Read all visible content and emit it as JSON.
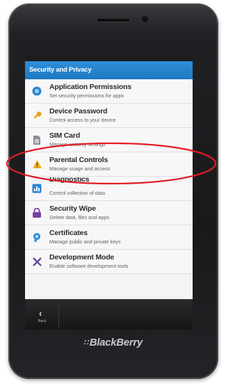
{
  "screen": {
    "header_title": "Security and Privacy"
  },
  "settings_items": [
    {
      "title": "Application Permissions",
      "description": "Set security permissions for apps",
      "icon": "app-permissions-icon"
    },
    {
      "title": "Device Password",
      "description": "Control access to your device",
      "icon": "key-icon"
    },
    {
      "title": "SIM Card",
      "description": "Manage security settings",
      "icon": "sim-card-icon"
    },
    {
      "title": "Parental Controls",
      "description": "Manage usage and access",
      "icon": "warning-icon"
    },
    {
      "title": "Diagnostics",
      "description": "Control collection of data",
      "icon": "diagnostics-icon"
    },
    {
      "title": "Security Wipe",
      "description": "Delete data, files and apps",
      "icon": "lock-icon"
    },
    {
      "title": "Certificates",
      "description": "Manage public and private keys",
      "icon": "certificate-icon"
    },
    {
      "title": "Development Mode",
      "description": "Enable software development tools",
      "icon": "tools-icon"
    }
  ],
  "bottom_bar": {
    "back_label": "Back"
  },
  "brand": {
    "name": "BlackBerry"
  },
  "colors": {
    "header": "#1f78c2",
    "annotation": "#e41b24"
  }
}
